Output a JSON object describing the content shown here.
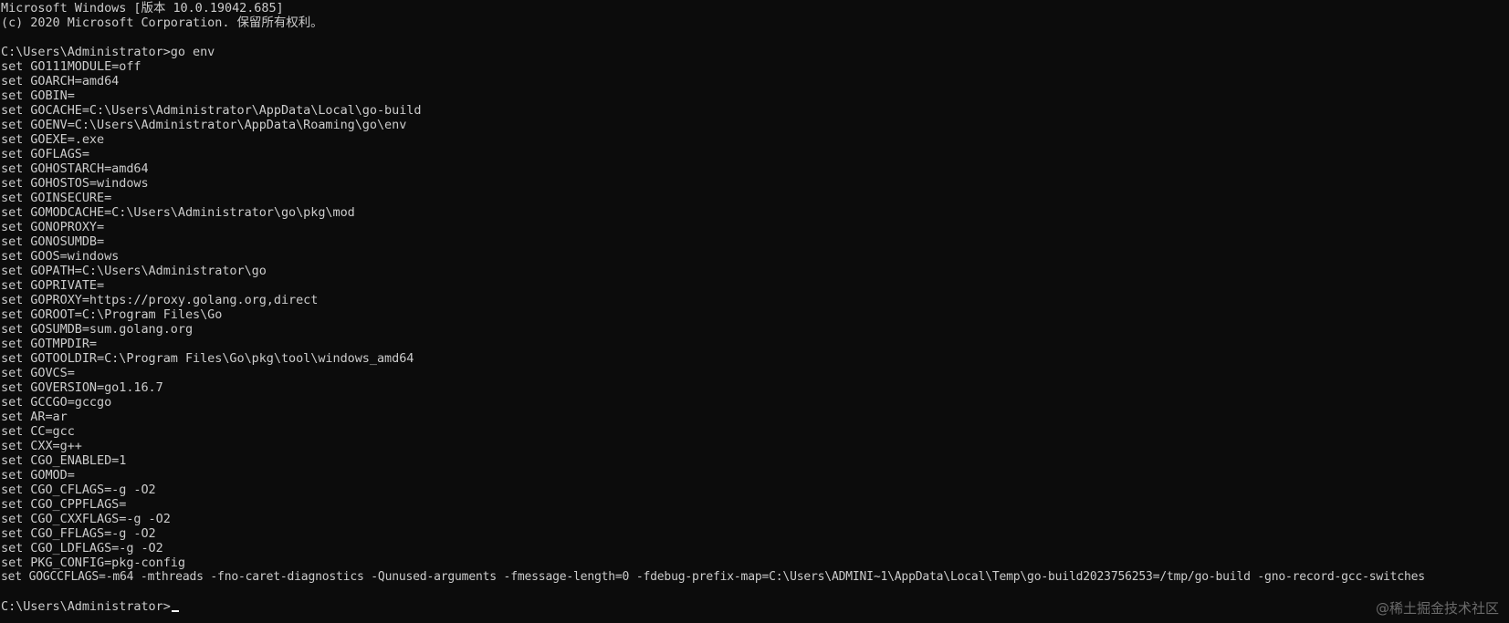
{
  "console": {
    "header": [
      "Microsoft Windows [版本 10.0.19042.685]",
      "(c) 2020 Microsoft Corporation. 保留所有权利。"
    ],
    "command": "C:\\Users\\Administrator>go env",
    "env": [
      "set GO111MODULE=off",
      "set GOARCH=amd64",
      "set GOBIN=",
      "set GOCACHE=C:\\Users\\Administrator\\AppData\\Local\\go-build",
      "set GOENV=C:\\Users\\Administrator\\AppData\\Roaming\\go\\env",
      "set GOEXE=.exe",
      "set GOFLAGS=",
      "set GOHOSTARCH=amd64",
      "set GOHOSTOS=windows",
      "set GOINSECURE=",
      "set GOMODCACHE=C:\\Users\\Administrator\\go\\pkg\\mod",
      "set GONOPROXY=",
      "set GONOSUMDB=",
      "set GOOS=windows",
      "set GOPATH=C:\\Users\\Administrator\\go",
      "set GOPRIVATE=",
      "set GOPROXY=https://proxy.golang.org,direct",
      "set GOROOT=C:\\Program Files\\Go",
      "set GOSUMDB=sum.golang.org",
      "set GOTMPDIR=",
      "set GOTOOLDIR=C:\\Program Files\\Go\\pkg\\tool\\windows_amd64",
      "set GOVCS=",
      "set GOVERSION=go1.16.7",
      "set GCCGO=gccgo",
      "set AR=ar",
      "set CC=gcc",
      "set CXX=g++",
      "set CGO_ENABLED=1",
      "set GOMOD=",
      "set CGO_CFLAGS=-g -O2",
      "set CGO_CPPFLAGS=",
      "set CGO_CXXFLAGS=-g -O2",
      "set CGO_FFLAGS=-g -O2",
      "set CGO_LDFLAGS=-g -O2",
      "set PKG_CONFIG=pkg-config",
      "set GOGCCFLAGS=-m64 -mthreads -fno-caret-diagnostics -Qunused-arguments -fmessage-length=0 -fdebug-prefix-map=C:\\Users\\ADMINI~1\\AppData\\Local\\Temp\\go-build2023756253=/tmp/go-build -gno-record-gcc-switches"
    ],
    "prompt": "C:\\Users\\Administrator>"
  },
  "watermark": "@稀土掘金技术社区"
}
